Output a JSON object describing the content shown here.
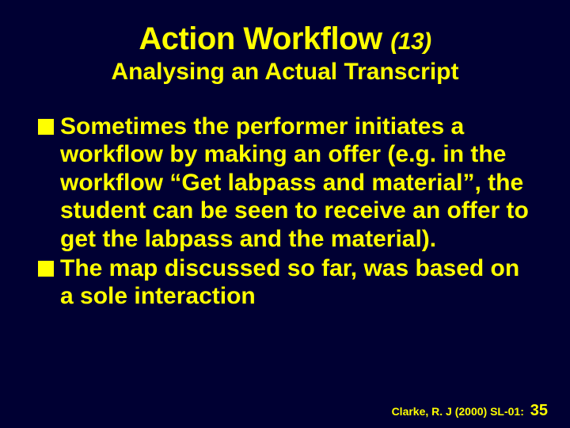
{
  "title": {
    "main": "Action Workflow",
    "num": "(13)",
    "subtitle": "Analysing an Actual Transcript"
  },
  "bullets": [
    "Sometimes the performer initiates a workflow by making an offer (e.g. in the workflow “Get labpass and material”, the student can be seen to receive an offer to get the labpass and the material).",
    "The map discussed so far, was based on a sole interaction"
  ],
  "footer": {
    "citation": "Clarke, R. J (2000) SL-01:",
    "page": "35"
  }
}
